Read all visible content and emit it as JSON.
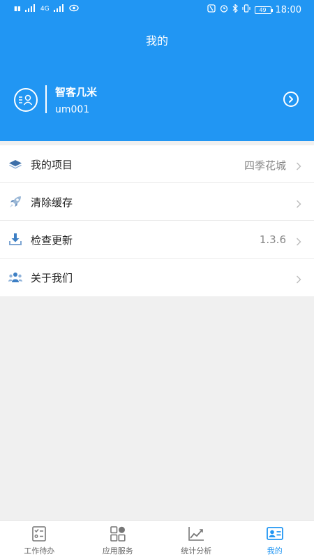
{
  "status_bar": {
    "left_text": "4G",
    "time": "18:00",
    "battery": "49"
  },
  "header": {
    "title": "我的"
  },
  "profile": {
    "name": "智客几米",
    "user_id": "um001"
  },
  "menu": [
    {
      "label": "我的项目",
      "value": "四季花城",
      "icon": "layers-icon"
    },
    {
      "label": "清除缓存",
      "value": "",
      "icon": "rocket-icon"
    },
    {
      "label": "检查更新",
      "value": "1.3.6",
      "icon": "download-icon"
    },
    {
      "label": "关于我们",
      "value": "",
      "icon": "team-icon"
    }
  ],
  "tabbar": [
    {
      "label": "工作待办",
      "icon": "checklist-icon",
      "active": false
    },
    {
      "label": "应用服务",
      "icon": "grid-icon",
      "active": false
    },
    {
      "label": "统计分析",
      "icon": "chart-icon",
      "active": false
    },
    {
      "label": "我的",
      "icon": "id-card-icon",
      "active": true
    }
  ],
  "colors": {
    "primary": "#2196f3",
    "background": "#f0f0f0",
    "text": "#222222",
    "muted": "#888888"
  }
}
